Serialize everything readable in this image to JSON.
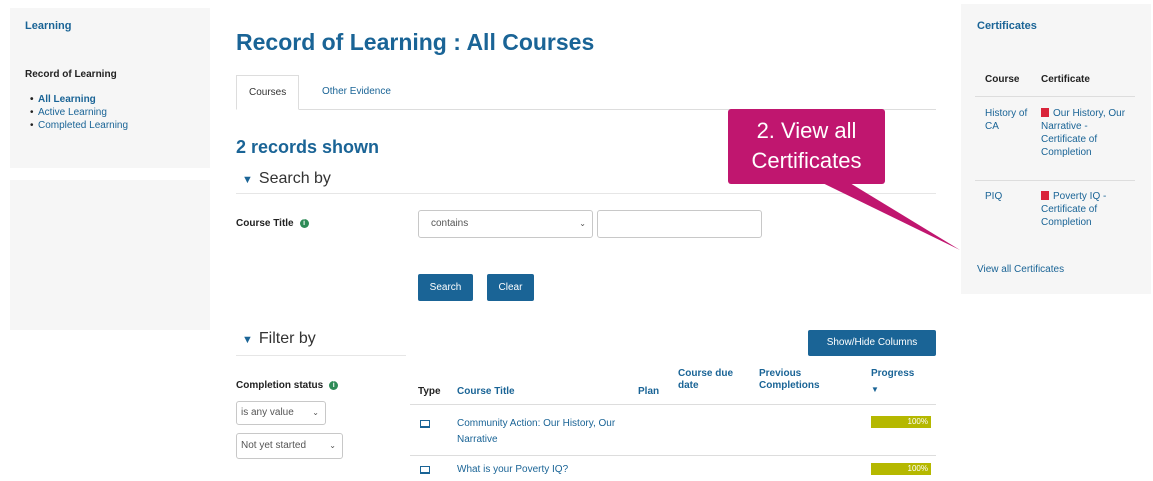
{
  "sidebar": {
    "title": "Learning",
    "section": "Record of Learning",
    "items": [
      {
        "label": "All Learning",
        "active": true
      },
      {
        "label": "Active Learning",
        "active": false
      },
      {
        "label": "Completed Learning",
        "active": false
      }
    ]
  },
  "main": {
    "title": "Record of Learning : All Courses",
    "tabs": [
      {
        "label": "Courses",
        "active": true
      },
      {
        "label": "Other Evidence",
        "active": false
      }
    ],
    "records_shown": "2 records shown",
    "search_by": "Search by",
    "course_title_label": "Course Title",
    "contains_select": "contains",
    "search_value": "",
    "search_button": "Search",
    "clear_button": "Clear",
    "filter_by": "Filter by",
    "completion_status_label": "Completion status",
    "completion_any": "is any value",
    "completion_value": "Not yet started",
    "show_hide_button": "Show/Hide Columns",
    "table": {
      "headers": {
        "type": "Type",
        "course_title": "Course Title",
        "plan": "Plan",
        "course_due_date": "Course due date",
        "previous_completions": "Previous Completions",
        "progress": "Progress"
      },
      "rows": [
        {
          "title": "Community Action: Our History, Our Narrative",
          "progress": "100%",
          "progress_fraction": 1.0,
          "type_icon": "laptop-icon"
        },
        {
          "title": "What is your Poverty IQ?",
          "progress": "100%",
          "progress_fraction": 1.0,
          "type_icon": "laptop-icon"
        }
      ]
    }
  },
  "certificates": {
    "title": "Certificates",
    "headers": {
      "course": "Course",
      "certificate": "Certificate"
    },
    "rows": [
      {
        "course": "History of CA",
        "certificate": "Our History, Our Narrative - Certificate of Completion"
      },
      {
        "course": "PIQ",
        "certificate": "Poverty IQ - Certificate of Completion"
      }
    ],
    "view_all": "View all Certificates"
  },
  "callout": {
    "text": "2. View all Certificates",
    "color": "#c0166f"
  },
  "colors": {
    "link": "#1a6496",
    "button": "#1a6496",
    "progress": "#b5b800",
    "pdf": "#d9243a"
  }
}
